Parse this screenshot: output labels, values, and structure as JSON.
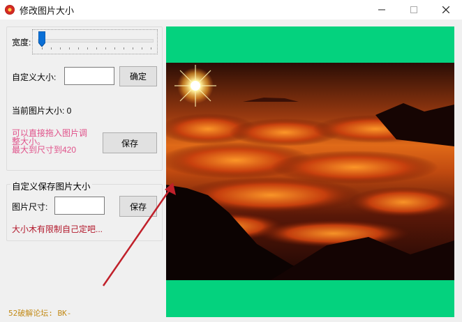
{
  "window": {
    "title": "修改图片大小"
  },
  "width_control": {
    "label": "宽度:"
  },
  "custom_size": {
    "label": "自定义大小:",
    "value": "",
    "confirm_label": "确定"
  },
  "current_size": {
    "label": "当前图片大小: 0"
  },
  "hint": {
    "line1": "可以直接拖入图片调",
    "line2": "整大小。",
    "line3": "最大到尺寸到420"
  },
  "save_button": {
    "label": "保存"
  },
  "custom_save_group": {
    "title": "自定义保存图片大小",
    "size_label": "图片尺寸:",
    "size_value": "",
    "save_label": "保存",
    "note": "大小木有限制自己定吧..."
  },
  "footer": {
    "text": "52破解论坛:  BK-"
  },
  "colors": {
    "canvas_bg": "#04d27e",
    "pink_text": "#e0528a",
    "red_text": "#b2182b",
    "footer_text": "#c28a17",
    "arrow": "#c0202a"
  }
}
